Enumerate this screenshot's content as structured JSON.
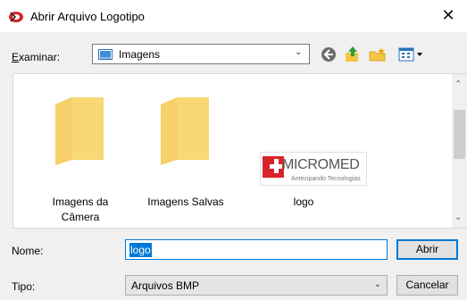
{
  "window": {
    "title": "Abrir Arquivo Logotipo",
    "close_glyph": "✕"
  },
  "toolbar": {
    "lookin_label": "Examinar:",
    "lookin_value": "Imagens",
    "icons": [
      "back-icon",
      "up-folder-icon",
      "new-folder-icon",
      "view-menu-icon"
    ]
  },
  "files": [
    {
      "label_line1": "Imagens da",
      "label_line2": "Câmera",
      "icon": "folder-icon"
    },
    {
      "label_line1": "Imagens Salvas",
      "label_line2": "",
      "icon": "folder-icon"
    },
    {
      "label_line1": "logo",
      "label_line2": "",
      "icon": "image-thumbnail",
      "thumb_brand": "MICROMED",
      "thumb_tagline": "Antecipando Tecnologias"
    }
  ],
  "form": {
    "name_label": "Nome:",
    "name_value": "logo",
    "type_label": "Tipo:",
    "type_value": "Arquivos BMP",
    "open_label": "Abrir",
    "cancel_label": "Cancelar"
  },
  "colors": {
    "accent": "#0078d7",
    "folder": "#f8d775",
    "brand_red": "#d9232a"
  }
}
